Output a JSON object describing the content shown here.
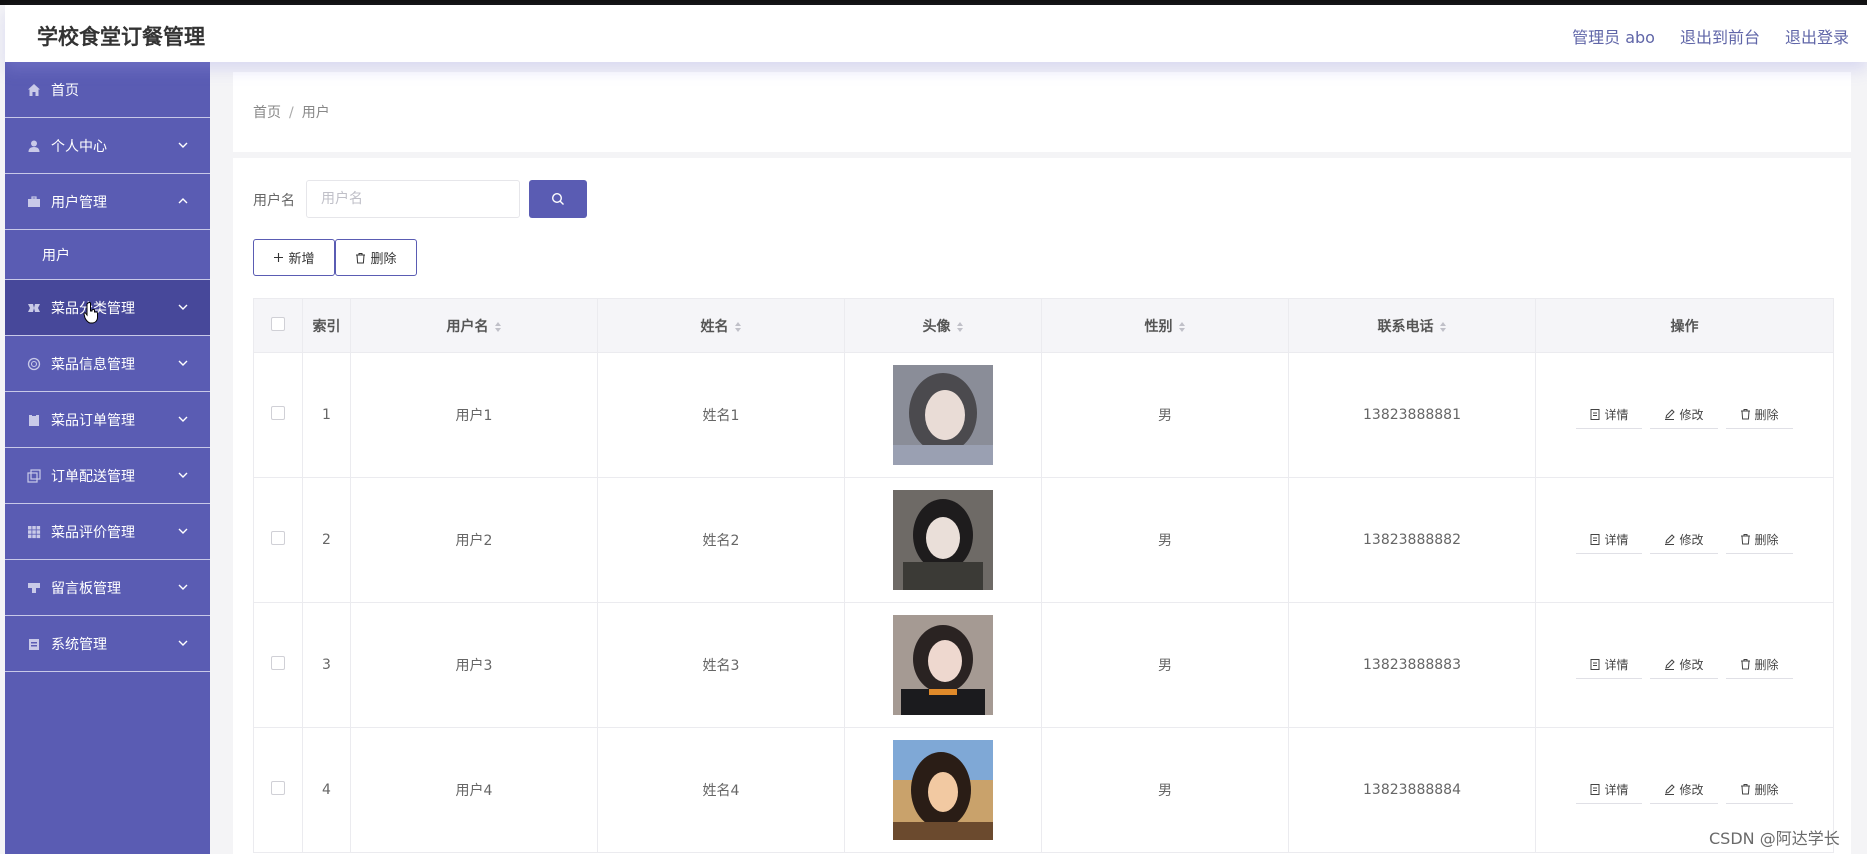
{
  "app": {
    "title": "学校食堂订餐管理"
  },
  "header": {
    "admin": "管理员 abo",
    "front": "退出到前台",
    "logout": "退出登录"
  },
  "sidebar": {
    "items": [
      {
        "label": "首页",
        "icon": "home-icon"
      },
      {
        "label": "个人中心",
        "icon": "user-icon"
      },
      {
        "label": "用户管理",
        "icon": "briefcase-icon"
      },
      {
        "label": "菜品分类管理",
        "icon": "category-icon"
      },
      {
        "label": "菜品信息管理",
        "icon": "circle-icon"
      },
      {
        "label": "菜品订单管理",
        "icon": "clipboard-icon"
      },
      {
        "label": "订单配送管理",
        "icon": "copy-icon"
      },
      {
        "label": "菜品评价管理",
        "icon": "grid-icon"
      },
      {
        "label": "留言板管理",
        "icon": "message-icon"
      },
      {
        "label": "系统管理",
        "icon": "settings-icon"
      }
    ],
    "sub": {
      "label": "用户"
    }
  },
  "breadcrumb": {
    "home": "首页",
    "separator": "/",
    "current": "用户"
  },
  "search": {
    "label": "用户名",
    "placeholder": "用户名"
  },
  "actions": {
    "add": "新增",
    "delete": "删除"
  },
  "table": {
    "headers": {
      "index": "索引",
      "username": "用户名",
      "name": "姓名",
      "avatar": "头像",
      "gender": "性别",
      "phone": "联系电话",
      "ops": "操作"
    },
    "ops": {
      "detail": "详情",
      "edit": "修改",
      "delete": "删除"
    },
    "rows": [
      {
        "index": "1",
        "username": "用户1",
        "name": "姓名1",
        "gender": "男",
        "phone": "13823888881"
      },
      {
        "index": "2",
        "username": "用户2",
        "name": "姓名2",
        "gender": "男",
        "phone": "13823888882"
      },
      {
        "index": "3",
        "username": "用户3",
        "name": "姓名3",
        "gender": "男",
        "phone": "13823888883"
      },
      {
        "index": "4",
        "username": "用户4",
        "name": "姓名4",
        "gender": "男",
        "phone": "13823888884"
      }
    ]
  },
  "watermark": "CSDN @阿达学长",
  "colors": {
    "accent": "#5a5cb3",
    "sidebar_hover": "#47489a"
  }
}
